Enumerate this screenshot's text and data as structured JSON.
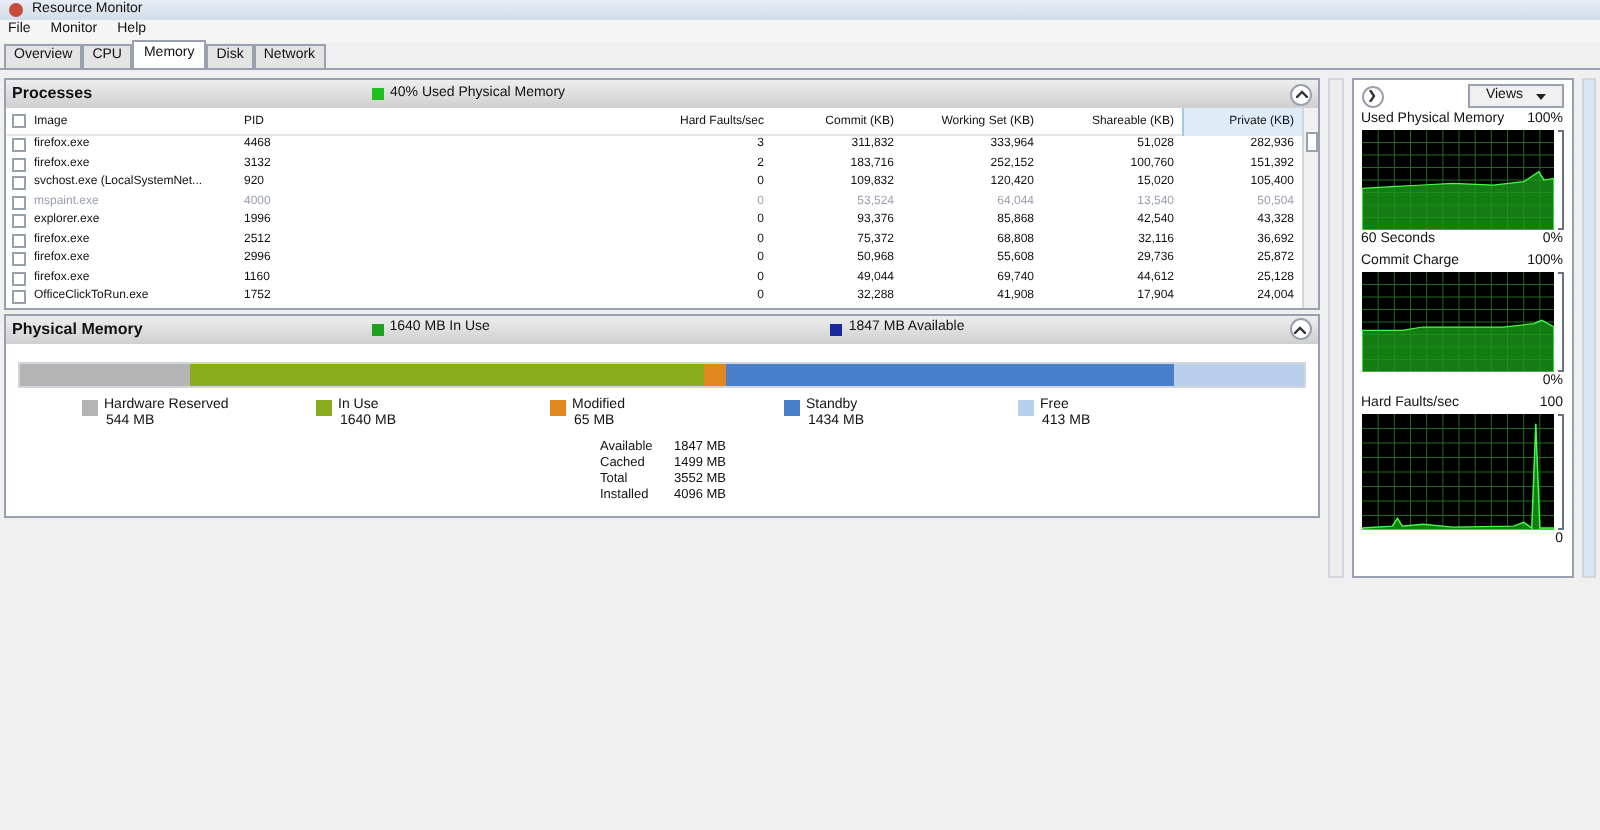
{
  "window": {
    "title": "Resource Monitor"
  },
  "menu": [
    "File",
    "Monitor",
    "Help"
  ],
  "tabs": [
    {
      "label": "Overview",
      "selected": false
    },
    {
      "label": "CPU",
      "selected": false
    },
    {
      "label": "Memory",
      "selected": true
    },
    {
      "label": "Disk",
      "selected": false
    },
    {
      "label": "Network",
      "selected": false
    }
  ],
  "processes": {
    "title": "Processes",
    "all_checked": false,
    "indicator": {
      "label": "40% Used Physical Memory",
      "color": "#20c020"
    },
    "columns": [
      {
        "label": "Image",
        "sorted": false
      },
      {
        "label": "PID",
        "sorted": false
      },
      {
        "label": "Hard Faults/sec",
        "sorted": false
      },
      {
        "label": "Commit (KB)",
        "sorted": false
      },
      {
        "label": "Working Set (KB)",
        "sorted": false
      },
      {
        "label": "Shareable (KB)",
        "sorted": false
      },
      {
        "label": "Private (KB)",
        "sorted": true
      }
    ],
    "rows": [
      {
        "checked": false,
        "disabled": false,
        "cells": [
          "firefox.exe",
          "4468",
          "3",
          "311,832",
          "333,964",
          "51,028",
          "282,936"
        ]
      },
      {
        "checked": false,
        "disabled": false,
        "cells": [
          "firefox.exe",
          "3132",
          "2",
          "183,716",
          "252,152",
          "100,760",
          "151,392"
        ]
      },
      {
        "checked": false,
        "disabled": false,
        "cells": [
          "svchost.exe (LocalSystemNet...",
          "920",
          "0",
          "109,832",
          "120,420",
          "15,020",
          "105,400"
        ]
      },
      {
        "checked": false,
        "disabled": true,
        "cells": [
          "mspaint.exe",
          "4000",
          "0",
          "53,524",
          "64,044",
          "13,540",
          "50,504"
        ]
      },
      {
        "checked": false,
        "disabled": false,
        "cells": [
          "explorer.exe",
          "1996",
          "0",
          "93,376",
          "85,868",
          "42,540",
          "43,328"
        ]
      },
      {
        "checked": false,
        "disabled": false,
        "cells": [
          "firefox.exe",
          "2512",
          "0",
          "75,372",
          "68,808",
          "32,116",
          "36,692"
        ]
      },
      {
        "checked": false,
        "disabled": false,
        "cells": [
          "firefox.exe",
          "2996",
          "0",
          "50,968",
          "55,608",
          "29,736",
          "25,872"
        ]
      },
      {
        "checked": false,
        "disabled": false,
        "cells": [
          "firefox.exe",
          "1160",
          "0",
          "49,044",
          "69,740",
          "44,612",
          "25,128"
        ]
      },
      {
        "checked": false,
        "disabled": false,
        "cells": [
          "OfficeClickToRun.exe",
          "1752",
          "0",
          "32,288",
          "41,908",
          "17,904",
          "24,004"
        ]
      }
    ]
  },
  "physical_memory": {
    "title": "Physical Memory",
    "indicators": [
      {
        "label": "1640 MB In Use",
        "color": "#20a020"
      },
      {
        "label": "1847 MB Available",
        "color": "#1a2a9a"
      }
    ],
    "segments": [
      {
        "label": "Hardware Reserved",
        "value": "544 MB",
        "color": "#b4b4b4"
      },
      {
        "label": "In Use",
        "value": "1640 MB",
        "color": "#8aac1e"
      },
      {
        "label": "Modified",
        "value": "65 MB",
        "color": "#e0881e"
      },
      {
        "label": "Standby",
        "value": "1434 MB",
        "color": "#4a7fcc"
      },
      {
        "label": "Free",
        "value": "413 MB",
        "color": "#b8d0ec"
      }
    ],
    "stats": [
      {
        "label": "Available",
        "value": "1847 MB"
      },
      {
        "label": "Cached",
        "value": "1499 MB"
      },
      {
        "label": "Total",
        "value": "3552 MB"
      },
      {
        "label": "Installed",
        "value": "4096 MB"
      }
    ]
  },
  "side_panel": {
    "views_button": "Views",
    "graphs": [
      {
        "title": "Used Physical Memory",
        "max": "100%",
        "min": "0%",
        "caption": "60 Seconds",
        "kind": "memory"
      },
      {
        "title": "Commit Charge",
        "max": "100%",
        "min": "0%",
        "kind": "commit"
      },
      {
        "title": "Hard Faults/sec",
        "max": "100",
        "min": "0",
        "kind": "faults"
      }
    ]
  }
}
